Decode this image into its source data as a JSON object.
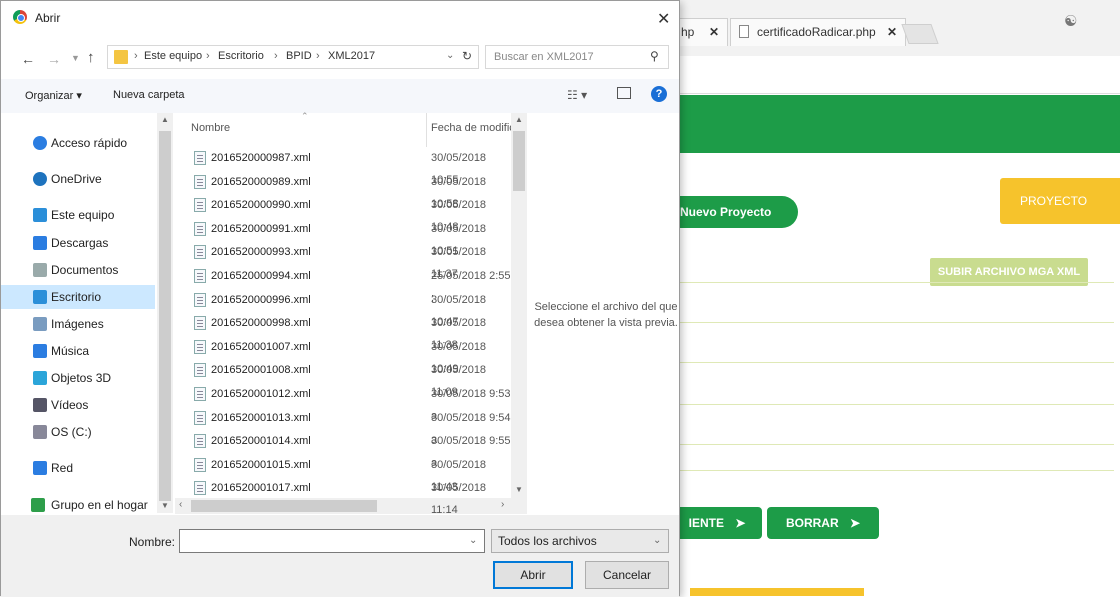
{
  "browser": {
    "tab1_label": "hp",
    "tab2_label": "certificadoRadicar.php",
    "close_glyph": "✕",
    "profile_icon": "person-icon"
  },
  "page": {
    "nuevo_proyecto": "Nuevo Proyecto",
    "proyecto_gener": "PROYECTO GENER",
    "subir_archivo": "SUBIR ARCHIVO MGA XML",
    "siguiente": "IENTE",
    "borrar": "BORRAR",
    "arrow": "➤",
    "colors": {
      "green": "#1d9c48",
      "yellow": "#f6c32c",
      "light_green": "#c9dc8f"
    }
  },
  "dialog": {
    "title": "Abrir",
    "close": "✕",
    "path": [
      "Este equipo",
      "Escritorio",
      "BPID",
      "XML2017"
    ],
    "search_placeholder": "Buscar en XML2017",
    "organizar": "Organizar ▾",
    "nueva_carpeta": "Nueva carpeta",
    "help": "?",
    "nav": [
      {
        "label": "Acceso rápido",
        "icon": "star-icon",
        "color": "#2b7de1"
      },
      {
        "label": "OneDrive",
        "icon": "cloud-icon",
        "color": "#1e73be"
      },
      {
        "label": "Este equipo",
        "icon": "computer-icon",
        "color": "#2b8fd9"
      },
      {
        "label": "Descargas",
        "icon": "download-icon",
        "color": "#2b7de1"
      },
      {
        "label": "Documentos",
        "icon": "document-icon",
        "color": "#9aa"
      },
      {
        "label": "Escritorio",
        "icon": "desktop-icon",
        "color": "#2b8fd9",
        "selected": true
      },
      {
        "label": "Imágenes",
        "icon": "image-icon",
        "color": "#7a9cc0"
      },
      {
        "label": "Música",
        "icon": "music-icon",
        "color": "#2b7de1"
      },
      {
        "label": "Objetos 3D",
        "icon": "cube-icon",
        "color": "#2ba5d9"
      },
      {
        "label": "Vídeos",
        "icon": "video-icon",
        "color": "#556"
      },
      {
        "label": "OS (C:)",
        "icon": "drive-icon",
        "color": "#889"
      },
      {
        "label": "Red",
        "icon": "network-icon",
        "color": "#2b7de1"
      },
      {
        "label": "Grupo en el hogar",
        "icon": "homegroup-icon",
        "color": "#2e9e4a"
      }
    ],
    "columns": {
      "name": "Nombre",
      "date": "Fecha de modific"
    },
    "files": [
      {
        "name": "2016520000987.xml",
        "date": "30/05/2018 10:55"
      },
      {
        "name": "2016520000989.xml",
        "date": "30/05/2018 10:58"
      },
      {
        "name": "2016520000990.xml",
        "date": "30/05/2018 10:48"
      },
      {
        "name": "2016520000991.xml",
        "date": "30/05/2018 10:51"
      },
      {
        "name": "2016520000993.xml",
        "date": "30/05/2018 11:37"
      },
      {
        "name": "2016520000994.xml",
        "date": "25/05/2018 2:55 ;"
      },
      {
        "name": "2016520000996.xml",
        "date": "30/05/2018 10:47"
      },
      {
        "name": "2016520000998.xml",
        "date": "30/05/2018 11:38"
      },
      {
        "name": "2016520001007.xml",
        "date": "30/05/2018 10:49"
      },
      {
        "name": "2016520001008.xml",
        "date": "30/05/2018 11:09"
      },
      {
        "name": "2016520001012.xml",
        "date": "30/05/2018 9:53 a"
      },
      {
        "name": "2016520001013.xml",
        "date": "30/05/2018 9:54 a"
      },
      {
        "name": "2016520001014.xml",
        "date": "30/05/2018 9:55 a"
      },
      {
        "name": "2016520001015.xml",
        "date": "30/05/2018 11:43"
      },
      {
        "name": "2016520001017.xml",
        "date": "30/05/2018 11:14"
      }
    ],
    "preview_text": "Seleccione el archivo del que desea obtener la vista previa.",
    "filename_label": "Nombre:",
    "filename_value": "",
    "filetype": "Todos los archivos",
    "open_button": "Abrir",
    "cancel_button": "Cancelar"
  }
}
